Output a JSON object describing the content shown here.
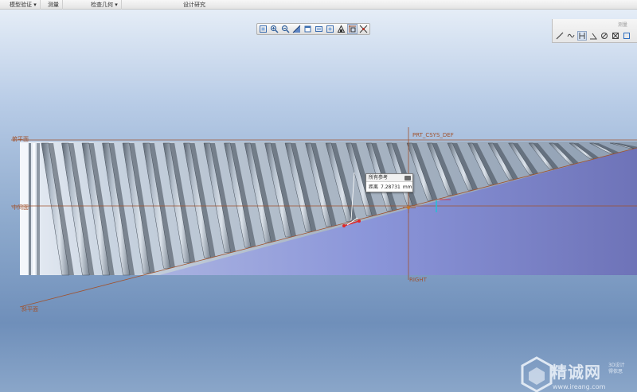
{
  "ribbon": {
    "groups": [
      "模型验证 ▾",
      "测量",
      "检查几何 ▾",
      "设计研究"
    ],
    "right_tab": "测量"
  },
  "graphics_toolbar": {
    "buttons": [
      "refit-icon",
      "zoom-in-icon",
      "zoom-out-icon",
      "repaint-icon",
      "display-style-icon",
      "saved-orientation-icon",
      "view-manager-icon",
      "perspective-icon",
      "datum-display-icon",
      "spin-center-icon"
    ],
    "active_index": 8
  },
  "sketch_palette": {
    "title": "测量",
    "buttons": [
      "pencil-icon",
      "curve-icon",
      "distance-icon",
      "angle-icon",
      "diameter-icon",
      "transform-icon",
      "summary-icon"
    ],
    "active_index": 2
  },
  "datums": {
    "top": "俯平面",
    "middle": "中间面",
    "bottom": "斜平面",
    "csys": "PRT_CSYS_DEF",
    "right": "RIGHT"
  },
  "measure_callout": {
    "title": "所有参考",
    "label": "距离",
    "value": "7.28731",
    "unit": "mm"
  },
  "watermark": {
    "brand": "精诚网",
    "side_top": "3D设计",
    "side_bottom": "得依思",
    "url": "www.ireang.com"
  },
  "colors": {
    "datum": "#a0522d",
    "measure_highlight": "#e02828",
    "dimension_cyan": "#19c6d8"
  }
}
